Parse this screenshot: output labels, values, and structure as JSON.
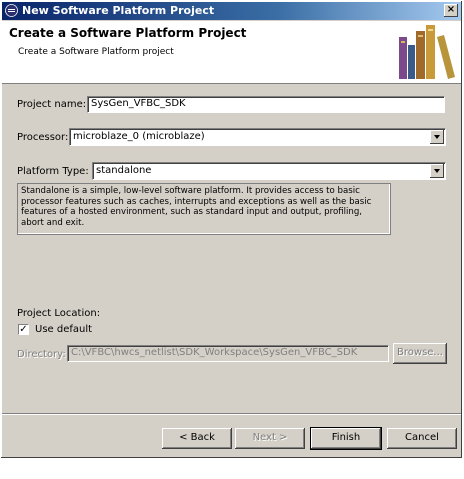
{
  "window": {
    "title": "New Software Platform Project",
    "close_label": "×"
  },
  "banner": {
    "heading": "Create a Software Platform Project",
    "subheading": "Create a Software Platform project",
    "image_icon": "books-icon"
  },
  "form": {
    "project_name_label": "Project name:",
    "project_name_value": "SysGen_VFBC_SDK",
    "processor_label": "Processor:",
    "processor_value": "microblaze_0 (microblaze)",
    "platform_type_label": "Platform Type:",
    "platform_type_value": "standalone",
    "description": "Standalone is a simple, low-level software platform. It provides access to basic processor features such as caches, interrupts and exceptions as well as the basic features of a hosted environment, such as standard input and output, profiling, abort and exit."
  },
  "location": {
    "heading": "Project Location:",
    "use_default_label": "Use default",
    "use_default_checked": true,
    "directory_label": "Directory:",
    "directory_value": "C:\\VFBC\\hwcs_netlist\\SDK_Workspace\\SysGen_VFBC_SDK",
    "browse_label": "Browse..."
  },
  "buttons": {
    "back": "< Back",
    "next": "Next >",
    "finish": "Finish",
    "cancel": "Cancel"
  }
}
